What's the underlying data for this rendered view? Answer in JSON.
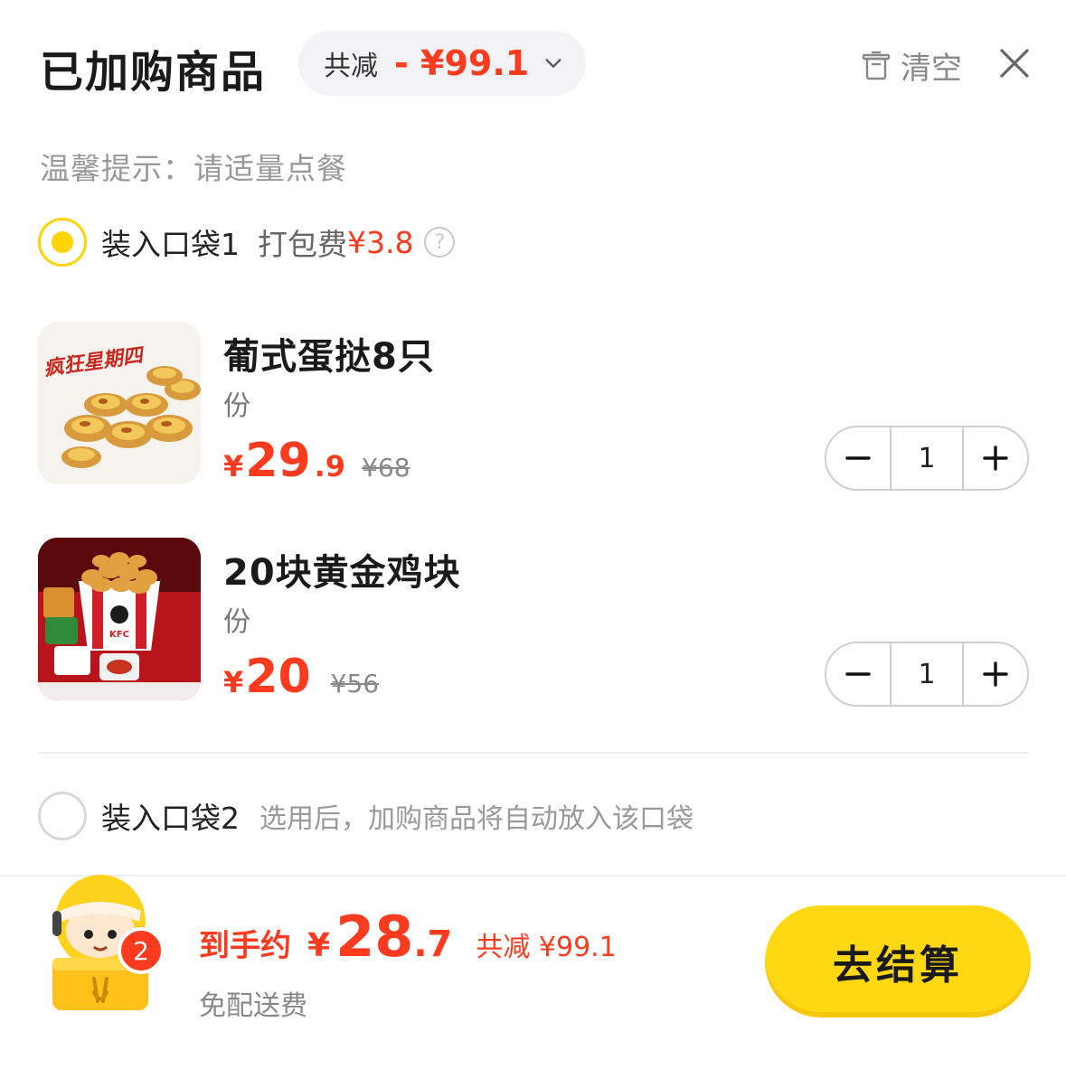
{
  "header": {
    "title": "已加购商品",
    "discount_label": "共减",
    "discount_amount": "- ¥99.1",
    "clear_label": "清空"
  },
  "tip": "温馨提示：请适量点餐",
  "bag1": {
    "name": "装入口袋1",
    "fee_label": "打包费",
    "fee_amount": "¥3.8",
    "help": "?"
  },
  "items": [
    {
      "name": "葡式蛋挞8只",
      "unit": "份",
      "price_yen": "¥",
      "price_int": "29",
      "price_dec": ".9",
      "original_price": "¥68",
      "quantity": "1",
      "thumb_text": "疯狂星期四"
    },
    {
      "name": "20块黄金鸡块",
      "unit": "份",
      "price_yen": "¥",
      "price_int": "20",
      "price_dec": "",
      "original_price": "¥56",
      "quantity": "1",
      "thumb_text": "KFC"
    }
  ],
  "bag2": {
    "name": "装入口袋2",
    "hint": "选用后，加购商品将自动放入该口袋"
  },
  "footer": {
    "cart_count": "2",
    "total_label": "到手约",
    "total_yen": "¥",
    "total_int": "28",
    "total_dec": ".7",
    "saved": "共减 ¥99.1",
    "delivery": "免配送费",
    "checkout_label": "去结算"
  },
  "colors": {
    "accent_red": "#ff3b1f",
    "brand_yellow": "#ffd814"
  }
}
